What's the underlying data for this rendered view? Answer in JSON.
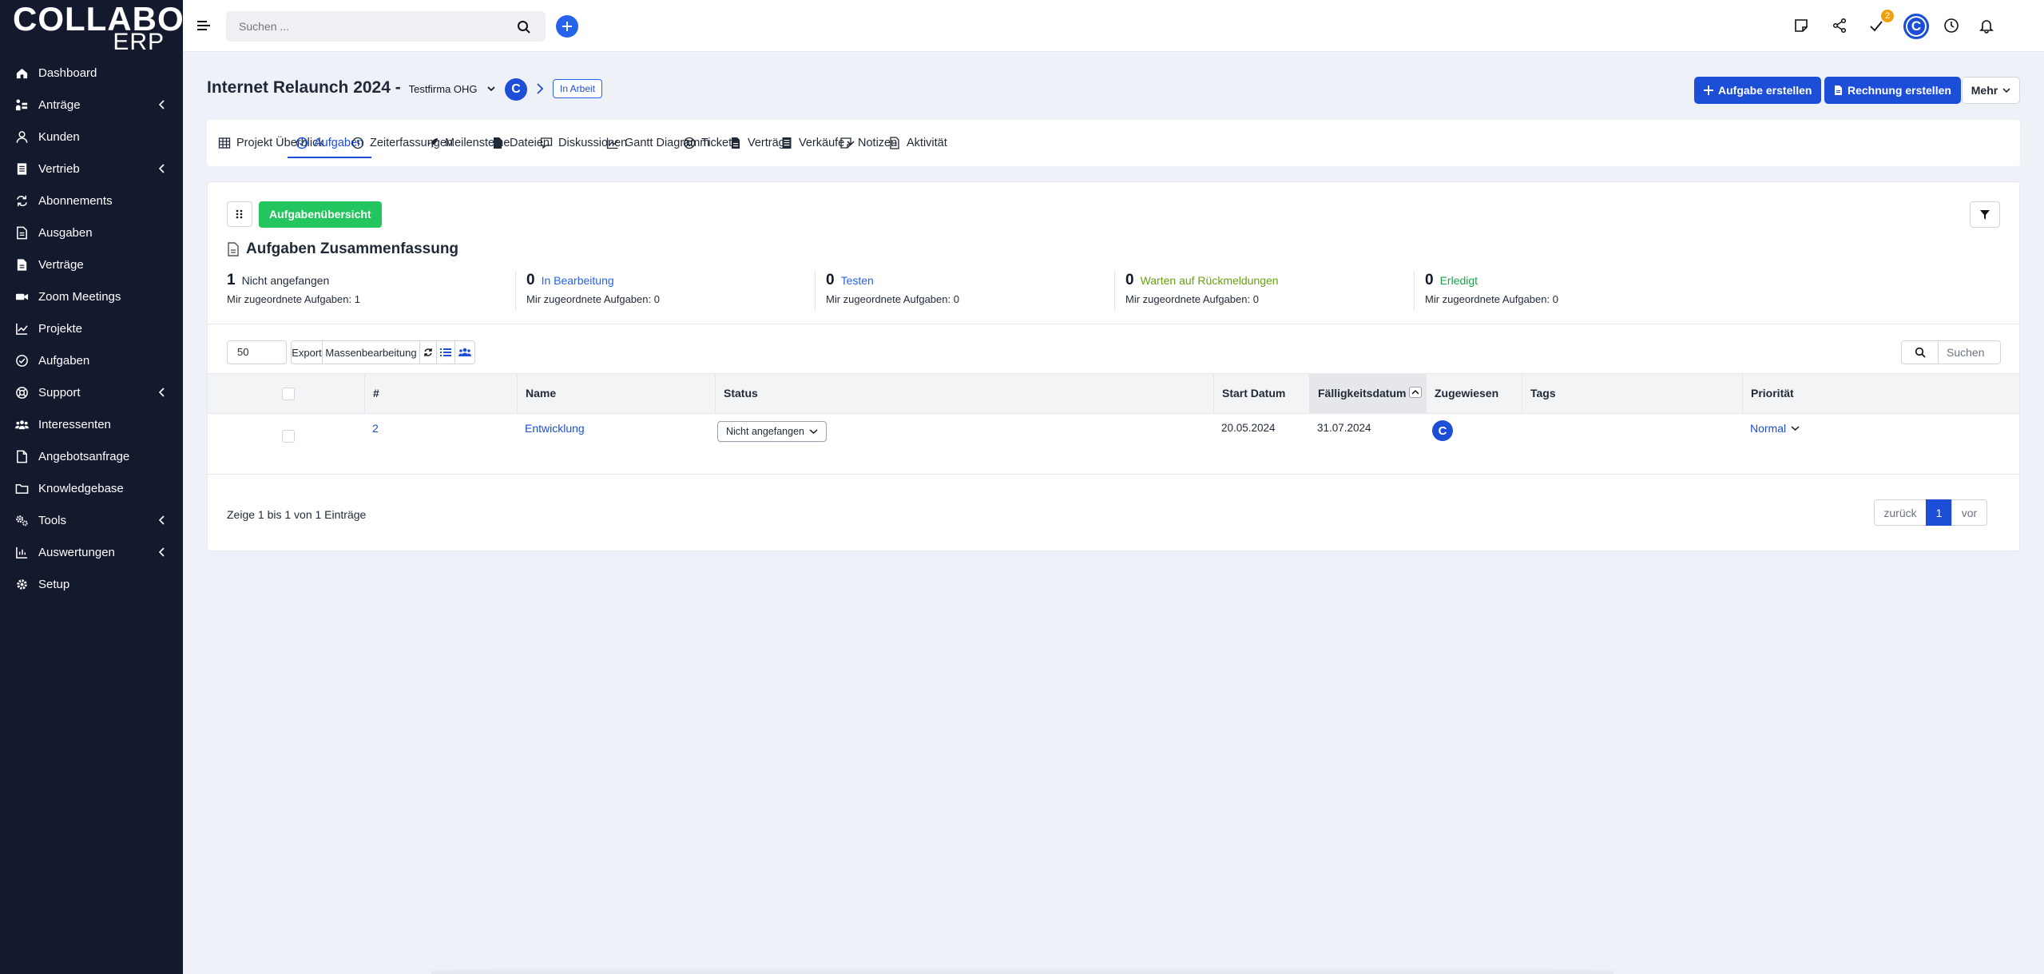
{
  "logo": {
    "line1": "COLLABO",
    "line2": "ERP"
  },
  "sidebar": {
    "items": [
      {
        "label": "Dashboard",
        "icon": "home-icon",
        "has_children": false
      },
      {
        "label": "Anträge",
        "icon": "workflow-icon",
        "has_children": true
      },
      {
        "label": "Kunden",
        "icon": "user-icon",
        "has_children": false
      },
      {
        "label": "Vertrieb",
        "icon": "ledger-icon",
        "has_children": true
      },
      {
        "label": "Abonnements",
        "icon": "repeat-icon",
        "has_children": false
      },
      {
        "label": "Ausgaben",
        "icon": "file-icon",
        "has_children": false
      },
      {
        "label": "Verträge",
        "icon": "contract-icon",
        "has_children": false
      },
      {
        "label": "Zoom Meetings",
        "icon": "video-icon",
        "has_children": false
      },
      {
        "label": "Projekte",
        "icon": "chart-icon",
        "has_children": false
      },
      {
        "label": "Aufgaben",
        "icon": "check-circle-icon",
        "has_children": false
      },
      {
        "label": "Support",
        "icon": "lifebuoy-icon",
        "has_children": true
      },
      {
        "label": "Interessenten",
        "icon": "people-icon",
        "has_children": false
      },
      {
        "label": "Angebotsanfrage",
        "icon": "document-icon",
        "has_children": false
      },
      {
        "label": "Knowledgebase",
        "icon": "folder-icon",
        "has_children": false
      },
      {
        "label": "Tools",
        "icon": "gears-icon",
        "has_children": true
      },
      {
        "label": "Auswertungen",
        "icon": "bar-chart-icon",
        "has_children": true
      },
      {
        "label": "Setup",
        "icon": "gear-icon",
        "has_children": false
      }
    ]
  },
  "topbar": {
    "search_placeholder": "Suchen ...",
    "todo_badge": "2",
    "avatar_letter": "C"
  },
  "project": {
    "title": "Internet Relaunch 2024 -",
    "company": "Testfirma OHG",
    "avatar_letter": "C",
    "status": "In Arbeit",
    "btn_create_task": "Aufgabe erstellen",
    "btn_create_invoice": "Rechnung erstellen",
    "btn_more": "Mehr"
  },
  "tabs": [
    {
      "label": "Projekt Überblick",
      "icon": "table-icon"
    },
    {
      "label": "Aufgaben",
      "icon": "check-circle-icon",
      "active": true
    },
    {
      "label": "Zeiterfassungen",
      "icon": "clock-icon"
    },
    {
      "label": "Meilensteine",
      "icon": "rocket-icon"
    },
    {
      "label": "Dateien",
      "icon": "file-icon"
    },
    {
      "label": "Diskussionen",
      "icon": "comment-icon"
    },
    {
      "label": "Gantt Diagramm",
      "icon": "chart-icon"
    },
    {
      "label": "Tickets",
      "icon": "lifebuoy-icon"
    },
    {
      "label": "Verträge",
      "icon": "contract-icon"
    },
    {
      "label": "Verkäufe",
      "icon": "ledger-icon",
      "dropdown": true
    },
    {
      "label": "Notizen",
      "icon": "note-icon"
    },
    {
      "label": "Aktivität",
      "icon": "document-icon"
    }
  ],
  "tasks": {
    "overview_button": "Aufgabenübersicht",
    "summary_title": "Aufgaben Zusammenfassung",
    "stats": [
      {
        "count": "1",
        "label": "Nicht angefangen",
        "sub": "Mir zugeordnete Aufgaben: 1",
        "color": "#1f2937"
      },
      {
        "count": "0",
        "label": "In Bearbeitung",
        "sub": "Mir zugeordnete Aufgaben: 0",
        "color": "#2563eb"
      },
      {
        "count": "0",
        "label": "Testen",
        "sub": "Mir zugeordnete Aufgaben: 0",
        "color": "#2563eb"
      },
      {
        "count": "0",
        "label": "Warten auf Rückmeldungen",
        "sub": "Mir zugeordnete Aufgaben: 0",
        "color": "#65a30d"
      },
      {
        "count": "0",
        "label": "Erledigt",
        "sub": "Mir zugeordnete Aufgaben: 0",
        "color": "#16a34a"
      }
    ],
    "page_length": "50",
    "btn_export": "Export",
    "btn_bulk": "Massenbearbeitung",
    "search_placeholder": "Suchen",
    "columns": [
      "#",
      "Name",
      "Status",
      "Start Datum",
      "Fälligkeitsdatum",
      "Zugewiesen",
      "Tags",
      "Priorität"
    ],
    "rows": [
      {
        "id": "2",
        "name": "Entwicklung",
        "status": "Nicht angefangen",
        "start": "20.05.2024",
        "due": "31.07.2024",
        "assignee": "C",
        "tags": "",
        "priority": "Normal"
      }
    ],
    "info": "Zeige 1 bis 1 von 1 Einträge",
    "pager": {
      "prev": "zurück",
      "current": "1",
      "next": "vor"
    }
  }
}
